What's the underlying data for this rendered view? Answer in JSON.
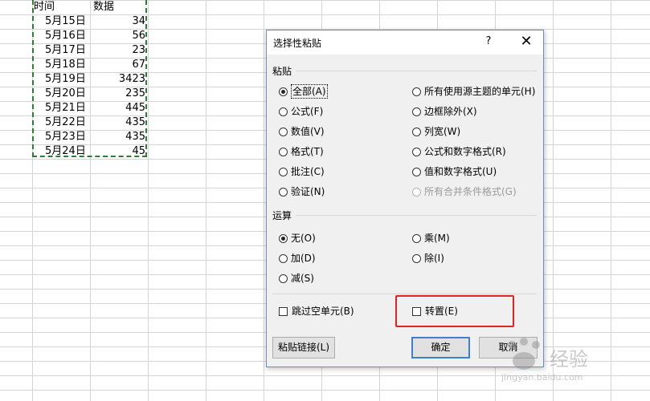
{
  "sheet": {
    "headers": [
      "时间",
      "数据"
    ],
    "rows": [
      {
        "date": "5月15日",
        "value": "34"
      },
      {
        "date": "5月16日",
        "value": "56"
      },
      {
        "date": "5月17日",
        "value": "23"
      },
      {
        "date": "5月18日",
        "value": "67"
      },
      {
        "date": "5月19日",
        "value": "3423"
      },
      {
        "date": "5月20日",
        "value": "235"
      },
      {
        "date": "5月21日",
        "value": "445"
      },
      {
        "date": "5月22日",
        "value": "435"
      },
      {
        "date": "5月23日",
        "value": "435"
      },
      {
        "date": "5月24日",
        "value": "45"
      }
    ]
  },
  "dialog": {
    "title": "选择性粘贴",
    "help": "?",
    "close": "✕",
    "paste_group": "粘贴",
    "paste_left": [
      "全部(A)",
      "公式(F)",
      "数值(V)",
      "格式(T)",
      "批注(C)",
      "验证(N)"
    ],
    "paste_right": [
      "所有使用源主题的单元(H)",
      "边框除外(X)",
      "列宽(W)",
      "公式和数字格式(R)",
      "值和数字格式(U)",
      "所有合并条件格式(G)"
    ],
    "operation_group": "运算",
    "operation_left": [
      "无(O)",
      "加(D)",
      "减(S)"
    ],
    "operation_right": [
      "乘(M)",
      "除(I)"
    ],
    "skip_blanks": "跳过空单元(B)",
    "transpose": "转置(E)",
    "paste_link_button": "粘贴链接(L)",
    "ok_button": "确定",
    "cancel_button": "取消",
    "selected_paste": "全部(A)",
    "selected_operation": "无(O)"
  },
  "watermark": {
    "text": "经验",
    "sub": "jingyan.baidu.com"
  },
  "colors": {
    "selection_border": "#2e7d32",
    "highlight_box": "#e52222",
    "default_button_border": "#3c7fd4"
  }
}
